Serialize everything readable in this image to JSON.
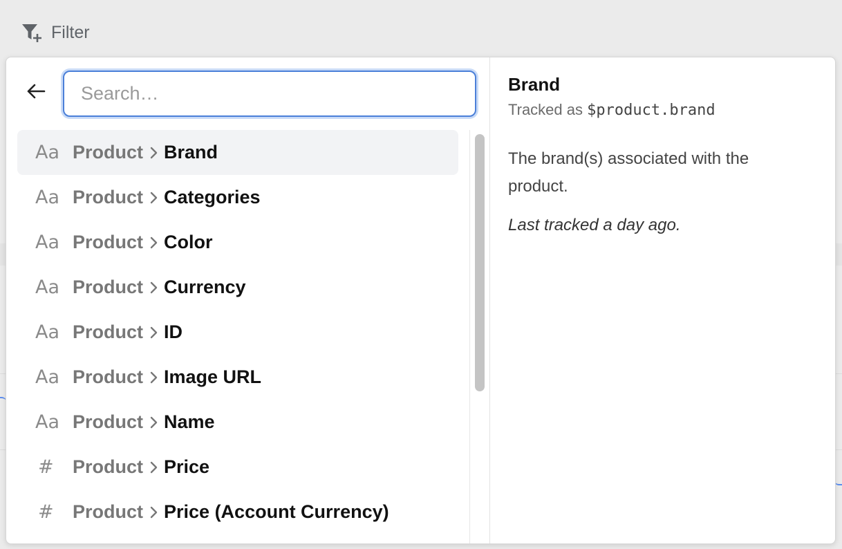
{
  "toolbar": {
    "filter_label": "Filter"
  },
  "search": {
    "placeholder": "Search…",
    "value": ""
  },
  "properties": [
    {
      "type_icon": "text-type-icon",
      "type_glyph": "Aa",
      "group": "Product",
      "name": "Brand",
      "selected": true
    },
    {
      "type_icon": "text-type-icon",
      "type_glyph": "Aa",
      "group": "Product",
      "name": "Categories"
    },
    {
      "type_icon": "text-type-icon",
      "type_glyph": "Aa",
      "group": "Product",
      "name": "Color"
    },
    {
      "type_icon": "text-type-icon",
      "type_glyph": "Aa",
      "group": "Product",
      "name": "Currency"
    },
    {
      "type_icon": "text-type-icon",
      "type_glyph": "Aa",
      "group": "Product",
      "name": "ID"
    },
    {
      "type_icon": "text-type-icon",
      "type_glyph": "Aa",
      "group": "Product",
      "name": "Image URL"
    },
    {
      "type_icon": "text-type-icon",
      "type_glyph": "Aa",
      "group": "Product",
      "name": "Name"
    },
    {
      "type_icon": "number-type-icon",
      "type_glyph": "#",
      "group": "Product",
      "name": "Price"
    },
    {
      "type_icon": "number-type-icon",
      "type_glyph": "#",
      "group": "Product",
      "name": "Price (Account Currency)"
    }
  ],
  "detail": {
    "title": "Brand",
    "tracked_prefix": "Tracked as",
    "tracked_key": "$product.brand",
    "description": "The brand(s) associated with the product.",
    "last_tracked": "Last tracked a day ago."
  },
  "colors": {
    "accent": "#4a7fd8",
    "selected_bg": "#f2f3f5",
    "muted_text": "#777777"
  }
}
